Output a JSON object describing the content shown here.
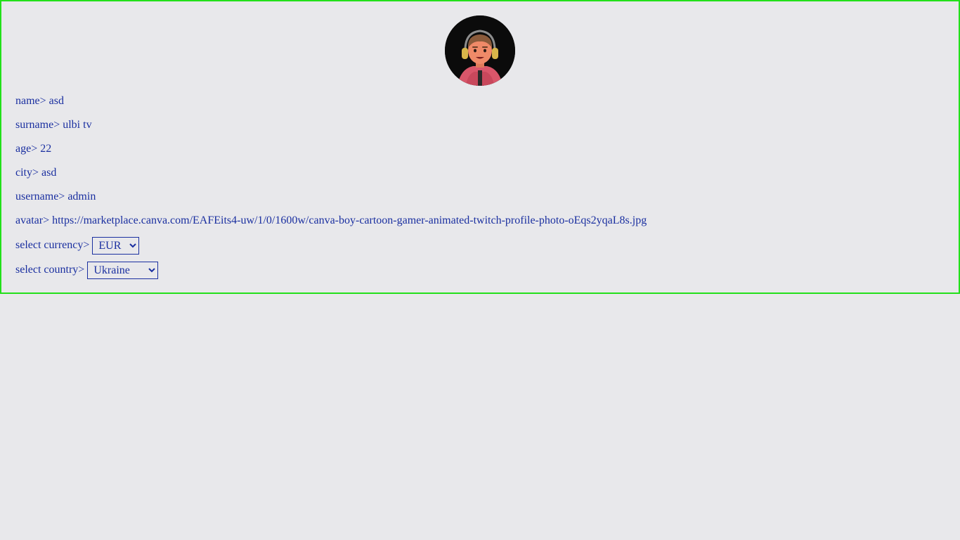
{
  "profile": {
    "name_label": "name>",
    "name_value": "asd",
    "surname_label": "surname>",
    "surname_value": "ulbi tv",
    "age_label": "age>",
    "age_value": "22",
    "city_label": "city>",
    "city_value": "asd",
    "username_label": "username>",
    "username_value": "admin",
    "avatar_label": "avatar>",
    "avatar_value": "https://marketplace.canva.com/EAFEits4-uw/1/0/1600w/canva-boy-cartoon-gamer-animated-twitch-profile-photo-oEqs2yqaL8s.jpg",
    "currency_label": "select currency>",
    "currency_selected": "EUR",
    "country_label": "select country>",
    "country_selected": "Ukraine"
  },
  "colors": {
    "border": "#22e01a",
    "text": "#1a2fa0",
    "background": "#e8e8eb"
  },
  "icons": {
    "avatar": "cartoon-gamer-avatar"
  }
}
